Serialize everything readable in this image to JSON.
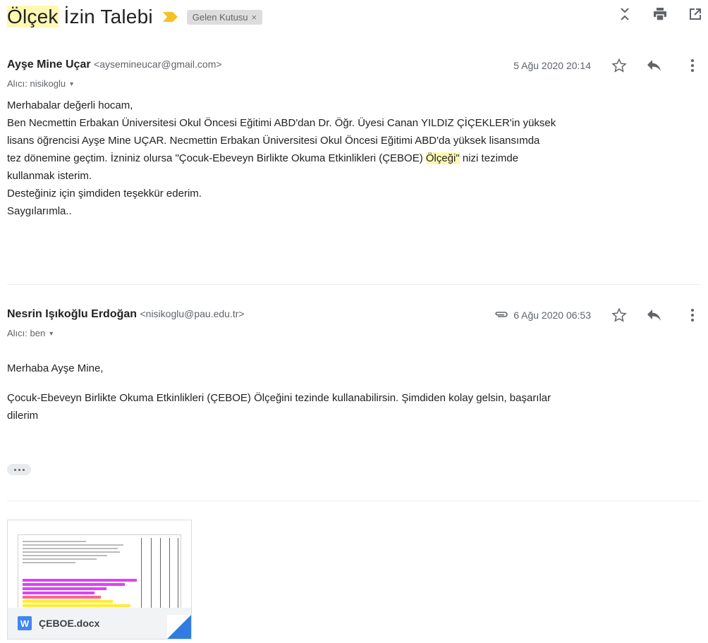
{
  "subject": {
    "word1": "Ölçek",
    "rest": " İzin Talebi"
  },
  "label_chip": {
    "text": "Gelen Kutusu",
    "close": "×"
  },
  "colors": {
    "importance": "#f6c026",
    "highlight": "#fff8b3",
    "word_icon": "#4285f4"
  },
  "top_actions": [
    {
      "name": "expand-all-icon"
    },
    {
      "name": "print-icon"
    },
    {
      "name": "open-in-new-window-icon"
    }
  ],
  "messages": [
    {
      "sender_name": "Ayşe Mine Uçar",
      "sender_email": "<aysemineucar@gmail.com>",
      "recipient": "Alıcı: nisikoglu",
      "date": "5 Ağu 2020 20:14",
      "has_attachment": false,
      "body": {
        "greeting": "Merhabalar değerli hocam,",
        "line1": "Ben Necmettin Erbakan Üniversitesi Okul Öncesi Eğitimi ABD'dan Dr. Öğr. Üyesi Canan YILDIZ ÇİÇEKLER'in yüksek",
        "line2": "lisans öğrencisi Ayşe Mine UÇAR.  Necmettin Erbakan Üniversitesi Okul Öncesi Eğitimi ABD'da yüksek lisansımda",
        "line3_pre": "tez dönemine geçtim. İzniniz olursa \"Çocuk-Ebeveyn Birlikte Okuma Etkinlikleri (ÇEBOE) ",
        "line3_hl": "Ölçeği\"",
        "line3_post": " nizi tezimde",
        "line4": "kullanmak isterim.",
        "thanks": "Desteğiniz için şimdiden teşekkür ederim.",
        "signoff": "Saygılarımla.."
      }
    },
    {
      "sender_name": "Nesrin Işıkoğlu Erdoğan",
      "sender_email": "<nisikoglu@pau.edu.tr>",
      "recipient": "Alıcı: ben",
      "date": "6 Ağu 2020 06:53",
      "has_attachment": true,
      "body": {
        "greeting": "Merhaba Ayşe Mine,",
        "line1": "Çocuk-Ebeveyn Birlikte Okuma Etkinlikleri (ÇEBOE) Ölçeğini tezinde kullanabilirsin. Şimdiden kolay gelsin, başarılar",
        "line2": "dilerim"
      }
    }
  ],
  "attachment": {
    "icon_letter": "W",
    "file_name": "ÇEBOE.docx"
  }
}
